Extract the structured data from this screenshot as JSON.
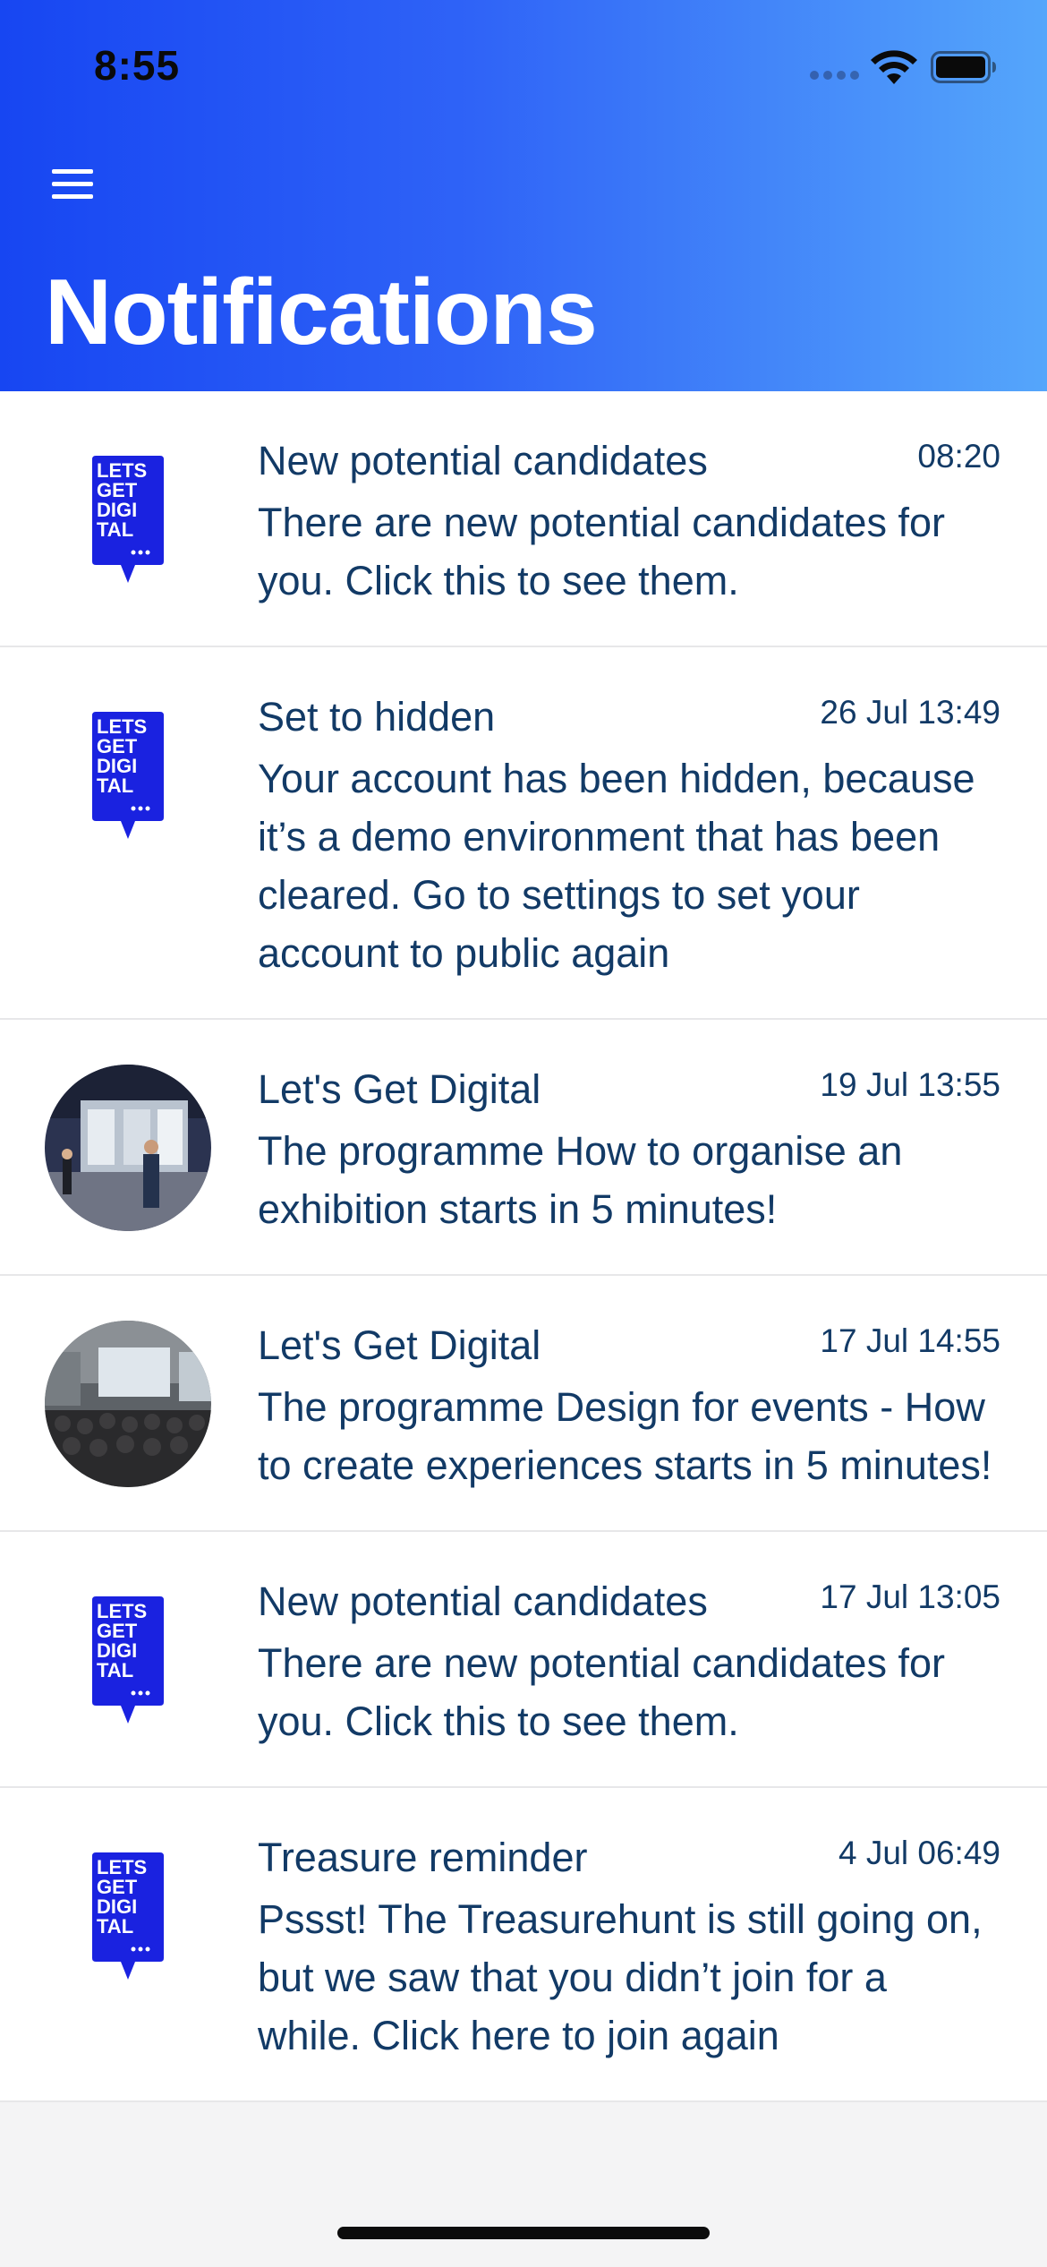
{
  "status_bar": {
    "time": "8:55"
  },
  "header": {
    "title": "Notifications",
    "menu_icon": "hamburger-menu-icon",
    "gradient_start": "#1746f2",
    "gradient_end": "#55a6fb"
  },
  "logo_text": [
    "LETS",
    "GET",
    "DIGI",
    "TAL"
  ],
  "notifications": [
    {
      "title": "New potential candidates",
      "date": "08:20",
      "body": "There are new potential candidates for you. Click this to see them.",
      "image": "logo"
    },
    {
      "title": "Set to hidden",
      "date": "26 Jul 13:49",
      "body": "Your account has been hidden, because it’s a demo environment that has been cleared. Go to settings to set your account to public again",
      "image": "logo"
    },
    {
      "title": "Let's Get Digital",
      "date": "19 Jul 13:55",
      "body": "The programme How to organise an exhibition starts in 5 minutes!",
      "image": "photo-exhibition"
    },
    {
      "title": "Let's Get Digital",
      "date": "17 Jul 14:55",
      "body": "The programme Design for events - How to create experiences starts in 5 minutes!",
      "image": "photo-audience"
    },
    {
      "title": "New potential candidates",
      "date": "17 Jul 13:05",
      "body": "There are new potential candidates for you. Click this to see them.",
      "image": "logo"
    },
    {
      "title": "Treasure reminder",
      "date": "4 Jul 06:49",
      "body": "Pssst! The Treasurehunt is still going on, but we saw that you didn’t join for a while. Click here to join again",
      "image": "logo"
    }
  ],
  "colors": {
    "text": "#123a66",
    "logo_blue": "#1a22e0",
    "divider": "#e7e7e9"
  }
}
